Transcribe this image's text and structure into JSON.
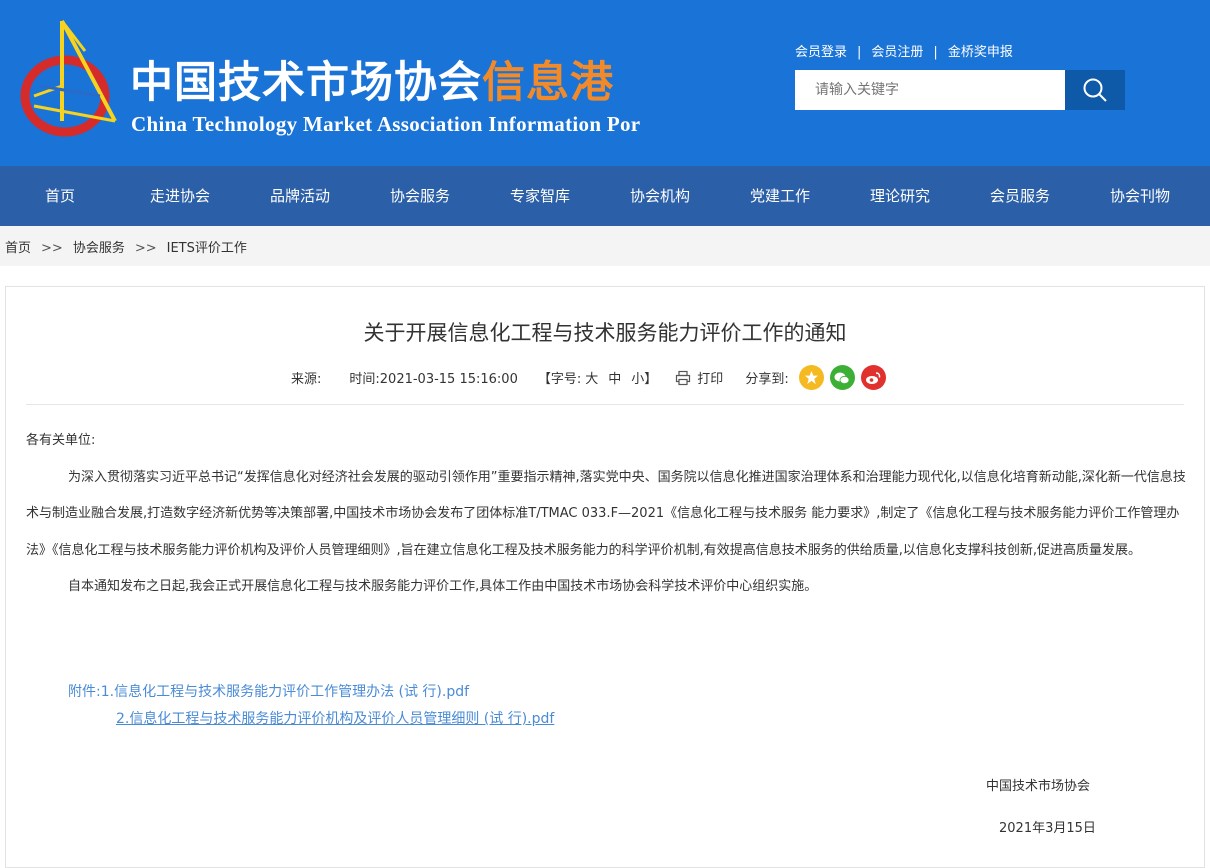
{
  "header": {
    "title_cn_main": "中国技术市场协会",
    "title_cn_highlight": "信息港",
    "title_en": "China Technology Market Association Information Por",
    "top_links": [
      "会员登录",
      "会员注册",
      "金桥奖申报"
    ],
    "search_placeholder": "请输入关键字",
    "search_icon": "search-icon"
  },
  "nav": [
    "首页",
    "走进协会",
    "品牌活动",
    "协会服务",
    "专家智库",
    "协会机构",
    "党建工作",
    "理论研究",
    "会员服务",
    "协会刊物"
  ],
  "breadcrumb": [
    "首页",
    "协会服务",
    "IETS评价工作"
  ],
  "breadcrumb_sep": ">>",
  "article": {
    "title": "关于开展信息化工程与技术服务能力评价工作的通知",
    "source_label": "来源:",
    "time": "时间:2021-03-15 15:16:00",
    "font_size_label": "【字号:",
    "font_sizes": [
      "大",
      "中",
      "小"
    ],
    "font_size_end": "】",
    "print": "打印",
    "share_label": "分享到:",
    "greeting": "各有关单位:",
    "paragraph1": "为深入贯彻落实习近平总书记“发挥信息化对经济社会发展的驱动引领作用”重要指示精神,落实党中央、国务院以信息化推进国家治理体系和治理能力现代化,以信息化培育新动能,深化新一代信息技术与制造业融合发展,打造数字经济新优势等决策部署,中国技术市场协会发布了团体标准T/TMAC 033.F—2021《信息化工程与技术服务 能力要求》,制定了《信息化工程与技术服务能力评价工作管理办法》《信息化工程与技术服务能力评价机构及评价人员管理细则》,旨在建立信息化工程及技术服务能力的科学评价机制,有效提高信息技术服务的供给质量,以信息化支撑科技创新,促进高质量发展。",
    "paragraph2": "自本通知发布之日起,我会正式开展信息化工程与技术服务能力评价工作,具体工作由中国技术市场协会科学技术评价中心组织实施。",
    "attachment_label": "附件:",
    "attachments": [
      "1.信息化工程与技术服务能力评价工作管理办法 (试 行).pdf",
      "2.信息化工程与技术服务能力评价机构及评价人员管理细则 (试 行).pdf"
    ],
    "signature": "中国技术市场协会",
    "date": "2021年3月15日"
  },
  "colors": {
    "header_bg": "#1a73d6",
    "nav_bg": "#2b5fa7",
    "accent_orange": "#f28a2a",
    "link_blue": "#4a8bd6"
  }
}
